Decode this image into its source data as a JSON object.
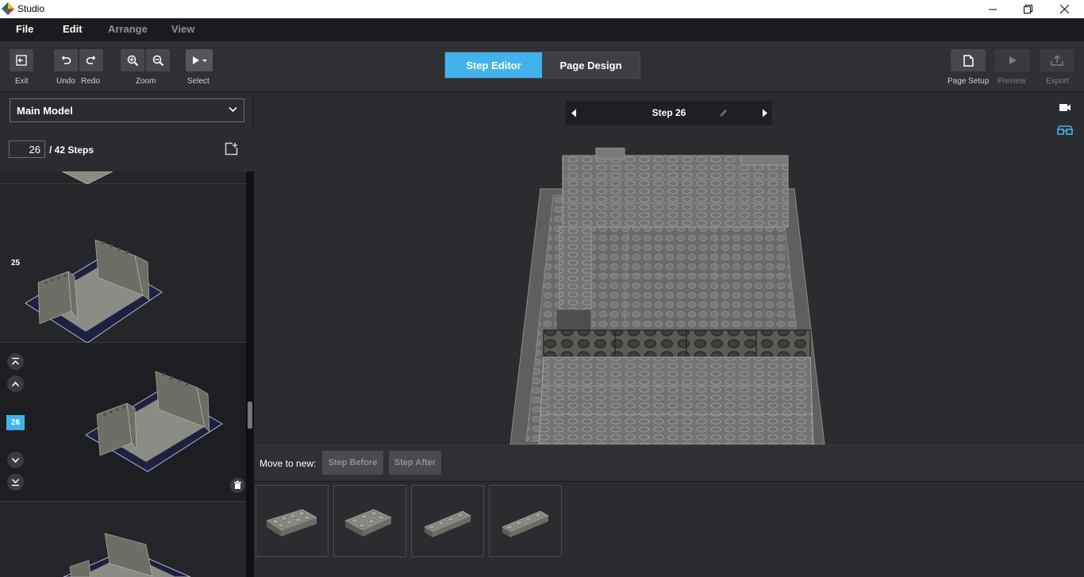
{
  "window": {
    "title": "Studio"
  },
  "menu": {
    "file": "File",
    "edit": "Edit",
    "arrange": "Arrange",
    "view": "View"
  },
  "toolbar": {
    "exit": "Exit",
    "undo": "Undo",
    "redo": "Redo",
    "zoom": "Zoom",
    "select": "Select",
    "page_setup": "Page Setup",
    "preview": "Preview",
    "export": "Export"
  },
  "modes": {
    "step_editor": "Step Editor",
    "page_design": "Page Design"
  },
  "left_panel": {
    "model": "Main Model",
    "current_step": "26",
    "total_steps": "/ 42 Steps",
    "thumbnails": [
      {
        "number": "25"
      },
      {
        "number": "26",
        "selected": true
      }
    ]
  },
  "viewport": {
    "step_title": "Step 26"
  },
  "move_bar": {
    "label": "Move to new:",
    "step_before": "Step Before",
    "step_after": "Step After"
  },
  "parts": [
    {
      "name": "plate-2x4"
    },
    {
      "name": "plate-2x3"
    },
    {
      "name": "plate-1x4"
    },
    {
      "name": "plate-1x4"
    }
  ],
  "colors": {
    "accent": "#41b3ea",
    "brick": "#6e6e66",
    "background": "#2b2c30"
  }
}
